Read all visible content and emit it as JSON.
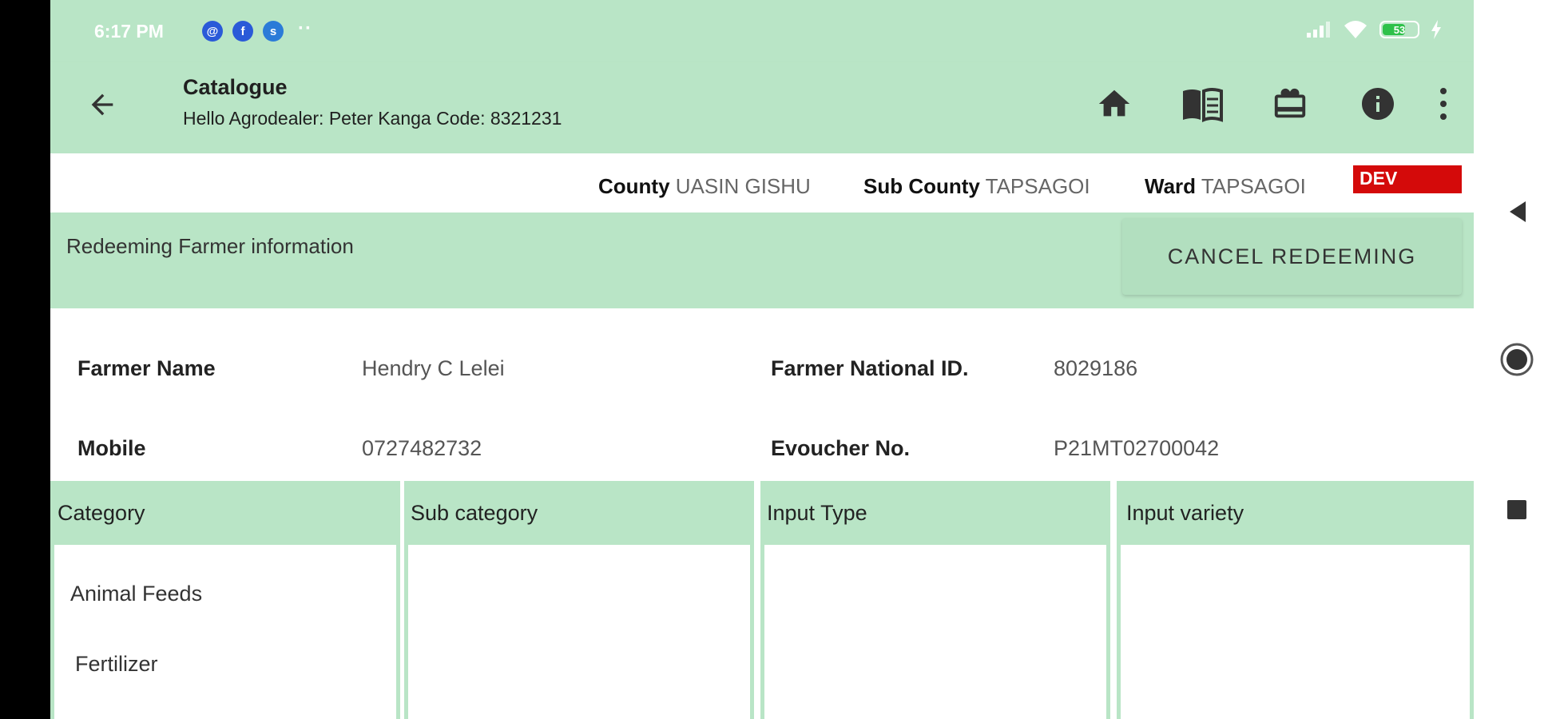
{
  "status_bar": {
    "time": "6:17 PM",
    "app_icons": [
      "@",
      "f",
      "s"
    ],
    "more": "··",
    "battery": "53"
  },
  "toolbar": {
    "title": "Catalogue",
    "subtitle": "Hello Agrodealer: Peter Kanga Code: 8321231",
    "icons": [
      "back-arrow-icon",
      "home-icon",
      "catalogue-book-icon",
      "voucher-icon",
      "info-icon",
      "more-vert-icon"
    ]
  },
  "location": {
    "county_label": "County",
    "county": "UASIN GISHU",
    "subcounty_label": "Sub County",
    "subcounty": "TAPSAGOI",
    "ward_label": "Ward",
    "ward": "TAPSAGOI",
    "env_badge": "DEV"
  },
  "redeem": {
    "title": "Redeeming Farmer information",
    "cancel_label": "CANCEL REDEEMING"
  },
  "farmer": {
    "name_label": "Farmer Name",
    "name": "Hendry C Lelei",
    "id_label": "Farmer National ID.",
    "id": "8029186",
    "mobile_label": "Mobile",
    "mobile": "0727482732",
    "voucher_label": "Evoucher No.",
    "voucher": "P21MT02700042"
  },
  "table": {
    "columns": [
      "Category",
      "Sub category",
      "Input Type",
      "Input variety"
    ],
    "categories": [
      "Animal Feeds",
      "Fertilizer"
    ]
  },
  "colors": {
    "accent_green": "#b9e5c6",
    "dev_red": "#d40a0a"
  }
}
